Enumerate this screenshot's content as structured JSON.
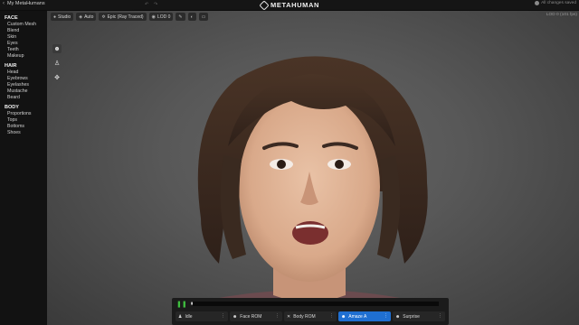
{
  "app": {
    "title": "My MetaHumans",
    "logo_text": "METAHUMAN",
    "save_status": "All changes saved"
  },
  "sidebar": {
    "sections": [
      {
        "label": "FACE",
        "items": [
          "Custom Mesh",
          "Blend",
          "Skin",
          "Eyes",
          "Teeth",
          "Makeup"
        ]
      },
      {
        "label": "HAIR",
        "items": [
          "Head",
          "Eyebrows",
          "Eyelashes",
          "Mustache",
          "Beard"
        ]
      },
      {
        "label": "BODY",
        "items": [
          "Proportions",
          "Tops",
          "Bottoms",
          "Shoes"
        ]
      }
    ]
  },
  "viewport": {
    "toolbar": {
      "lighting": "Studio",
      "camera": "Auto",
      "quality": "Epic (Ray Traced)",
      "lod": "LOD 0"
    },
    "lod_info": "LOD 0 (101 fps)"
  },
  "animation": {
    "presets": [
      {
        "label": "Idle",
        "active": false
      },
      {
        "label": "Face ROM",
        "active": false
      },
      {
        "label": "Body ROM",
        "active": false
      },
      {
        "label": "Amaze A",
        "active": true
      },
      {
        "label": "Surprise",
        "active": false
      }
    ]
  },
  "colors": {
    "accent": "#1f6fd1",
    "play": "#3fbf3f"
  }
}
